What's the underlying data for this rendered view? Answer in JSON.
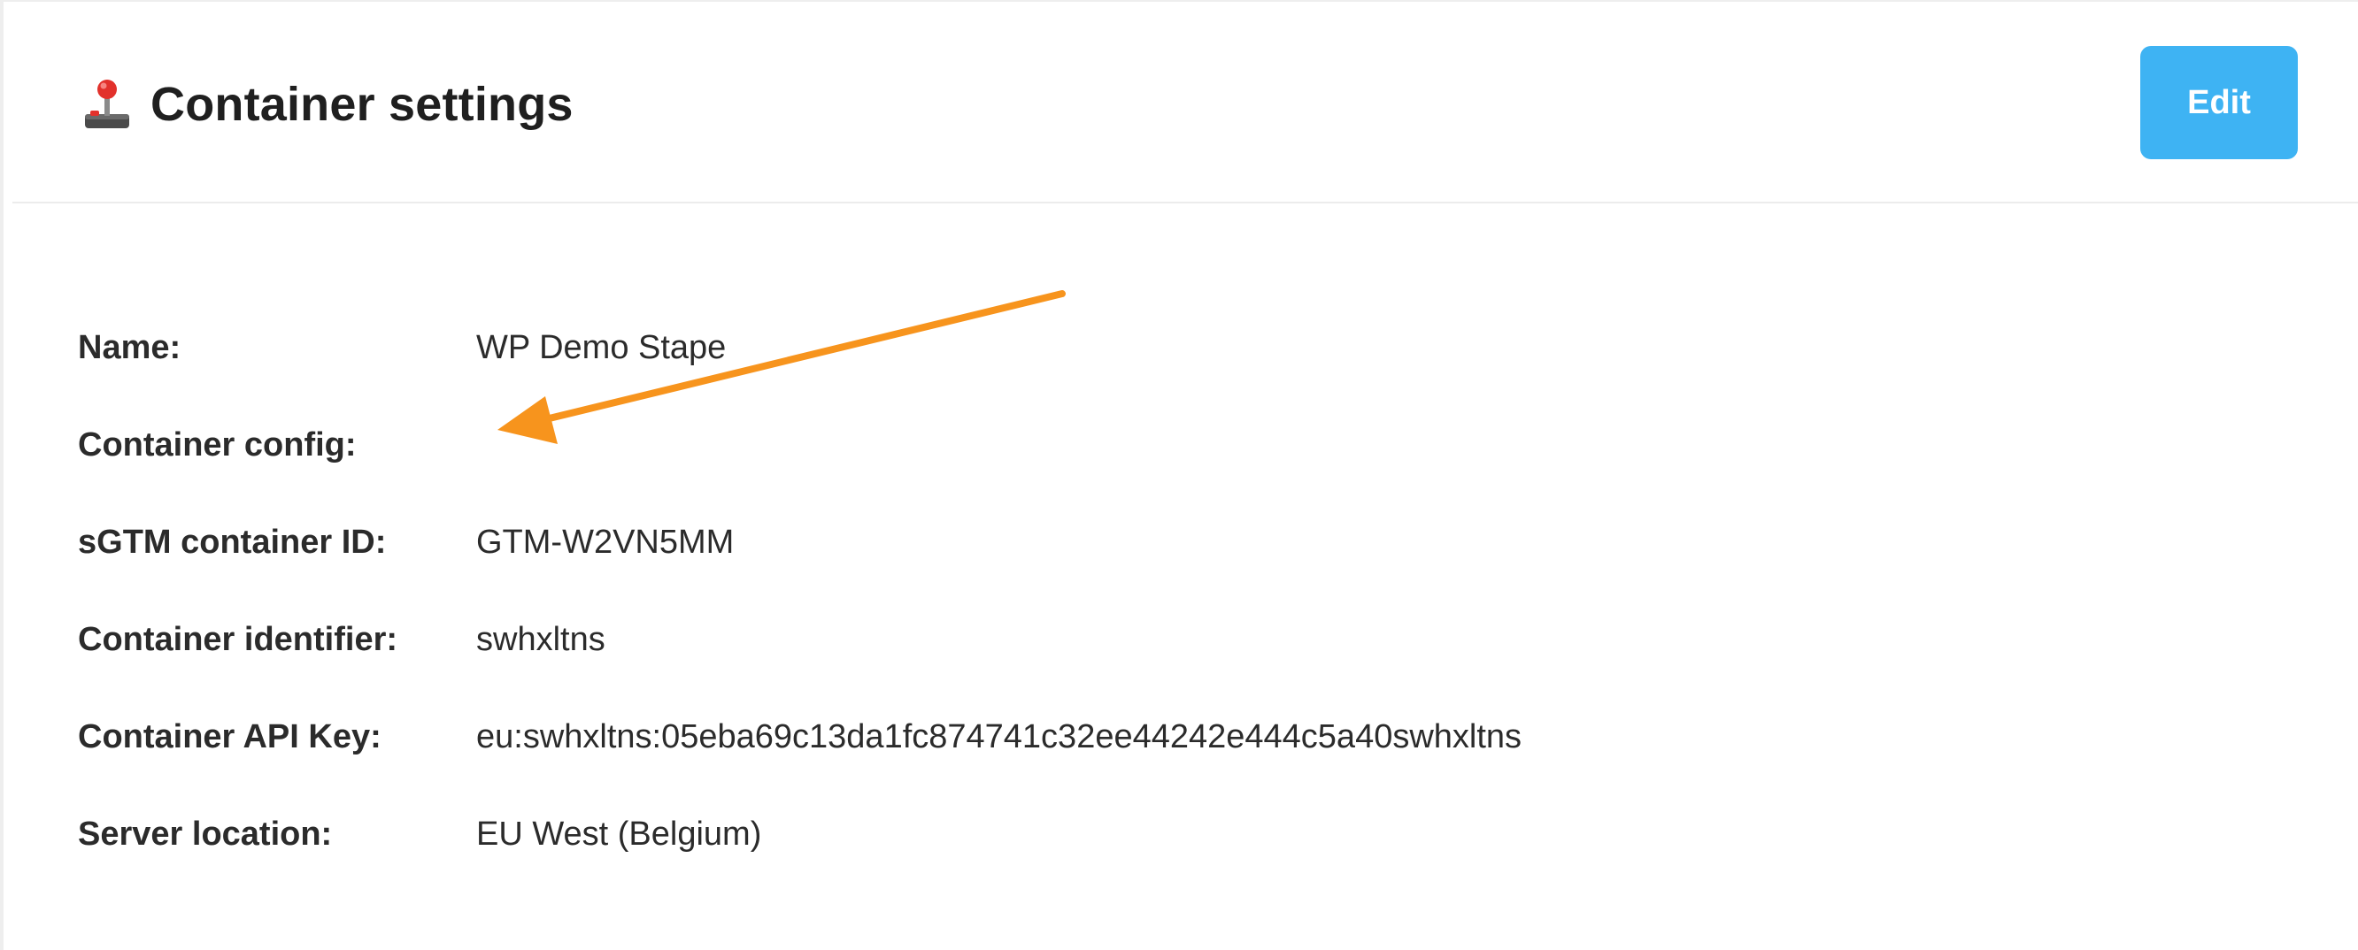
{
  "header": {
    "title": "Container settings",
    "title_icon": "joystick-icon",
    "edit_label": "Edit"
  },
  "fields": [
    {
      "label": "Name:",
      "value": "WP Demo Stape"
    },
    {
      "label": "Container config:",
      "value": ""
    },
    {
      "label": "sGTM container ID:",
      "value": "GTM-W2VN5MM"
    },
    {
      "label": "Container identifier:",
      "value": "swhxltns"
    },
    {
      "label": "Container API Key:",
      "value": "eu:swhxltns:05eba69c13da1fc874741c32ee44242e444c5a40swhxltns"
    },
    {
      "label": "Server location:",
      "value": "EU West (Belgium)"
    }
  ],
  "colors": {
    "accent": "#3eb3f3",
    "annotation": "#f7941d"
  }
}
